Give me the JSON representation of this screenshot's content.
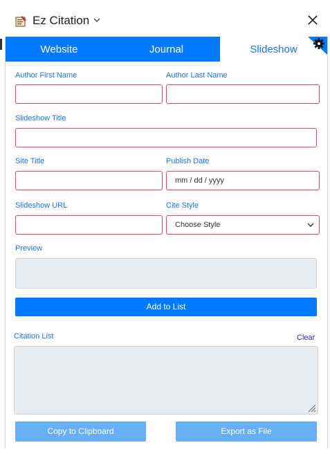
{
  "header": {
    "title": "Ez Citation",
    "app_icon": "ez-citation-logo-icon",
    "chevron_icon": "chevron-down-icon",
    "close_icon": "close-icon"
  },
  "tabs": [
    {
      "label": "Website",
      "active": false
    },
    {
      "label": "Journal",
      "active": false
    },
    {
      "label": "Slideshow",
      "active": true
    }
  ],
  "settings_icon": "gear-icon",
  "form": {
    "author_first_label": "Author First Name",
    "author_last_label": "Author Last Name",
    "slideshow_title_label": "Slideshow Title",
    "site_title_label": "Site Title",
    "publish_date_label": "Publish Date",
    "publish_date_placeholder": "mm / dd / yyyy",
    "slideshow_url_label": "Slideshow URL",
    "cite_style_label": "Cite Style",
    "cite_style_value": "Choose Style",
    "preview_label": "Preview",
    "add_button": "Add to List"
  },
  "citation_list": {
    "label": "Citation List",
    "clear_link": "Clear"
  },
  "footer": {
    "copy_button": "Copy to Clipboard",
    "export_button": "Export as File"
  },
  "colors": {
    "accent": "#007bff",
    "label_blue": "#1a73e8",
    "error_border": "#d94b56",
    "disabled_button": "#66aef5"
  }
}
